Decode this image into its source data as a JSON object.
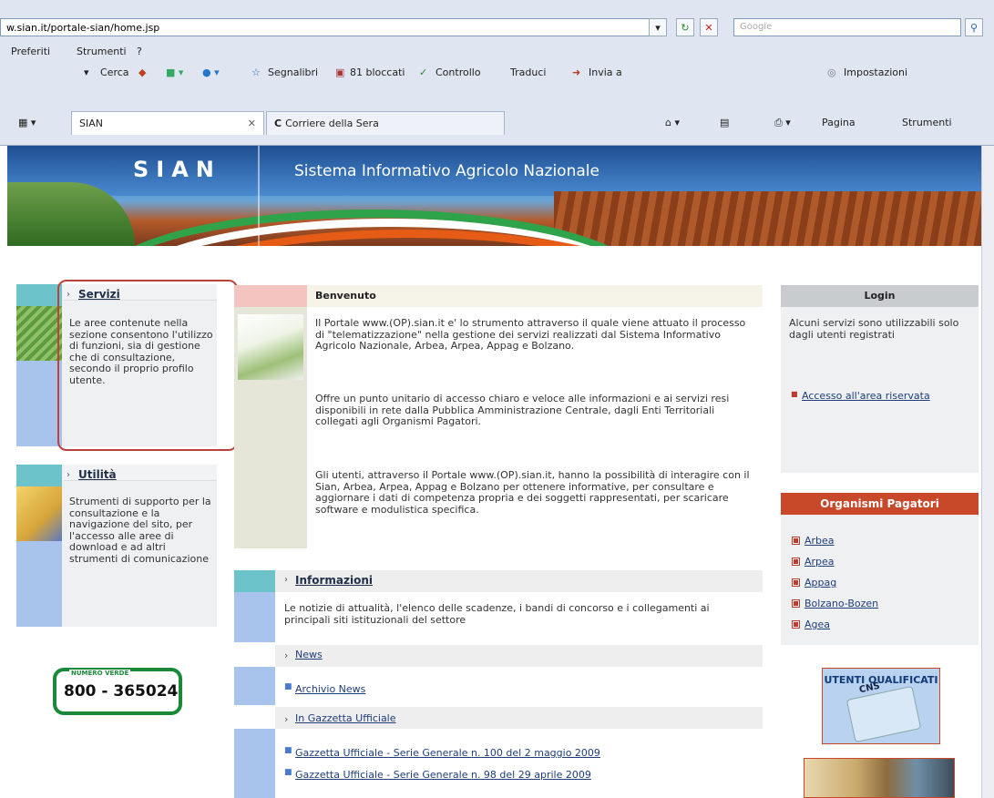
{
  "browser": {
    "url": "w.sian.it/portale-sian/home.jsp",
    "search_placeholder": "Google",
    "menu": [
      "Preferiti",
      "Strumenti",
      "?"
    ],
    "toolbar": {
      "cerca": "Cerca",
      "segnalibri": "Segnalibri",
      "bloccati": "81 bloccati",
      "controllo": "Controllo",
      "traduci": "Traduci",
      "invia": "Invia a",
      "impostazioni": "Impostazioni"
    },
    "tabs": [
      {
        "label": "SIAN",
        "active": true
      },
      {
        "label": "Corriere della Sera",
        "active": false
      }
    ],
    "tab_tools": {
      "pagina": "Pagina",
      "strumenti": "Strumenti"
    }
  },
  "banner": {
    "logo": "SIAN",
    "title": "Sistema Informativo Agricolo Nazionale"
  },
  "left": {
    "servizi": {
      "title": "Servizi",
      "text": "Le aree contenute nella sezione consentono l'utilizzo di funzioni, sia di gestione che di consultazione, secondo il proprio profilo utente."
    },
    "utilita": {
      "title": "Utilità",
      "text": "Strumenti di supporto per la consultazione e la navigazione del sito, per l'accesso alle aree di download e ad altri strumenti di comunicazione"
    },
    "numero_verde": {
      "label": "NUMERO VERDE",
      "number": "800 - 365024"
    }
  },
  "center": {
    "benvenuto": {
      "title": "Benvenuto",
      "p1": "Il Portale www.(OP).sian.it e' lo strumento attraverso il quale viene attuato il processo di \"telematizzazione\" nella gestione dei servizi realizzati dal Sistema Informativo Agricolo Nazionale, Arbea, Arpea, Appag e Bolzano.",
      "p2": "Offre un punto unitario di accesso chiaro e veloce alle informazioni e ai servizi resi disponibili in rete dalla Pubblica Amministrazione Centrale, dagli Enti Territoriali collegati agli Organismi Pagatori.",
      "p3": "Gli utenti, attraverso il Portale www.(OP).sian.it, hanno la possibilità di interagire con il Sian, Arbea, Arpea, Appag e Bolzano per ottenere informative, per consultare e aggiornare i dati di competenza propria e dei soggetti rappresentati, per scaricare software e modulistica specifica."
    },
    "informazioni": {
      "title": "Informazioni",
      "text": "Le notizie di attualità, l'elenco delle scadenze, i bandi di concorso e i collegamenti ai principali siti istituzionali del settore"
    },
    "news": {
      "news_label": "News",
      "archivio": "Archivio News",
      "gazzetta_label": "In Gazzetta Ufficiale",
      "gazzetta_items": [
        "Gazzetta Ufficiale - Serie Generale n. 100 del 2 maggio 2009",
        "Gazzetta Ufficiale - Serie Generale n. 98 del 29 aprile 2009"
      ]
    }
  },
  "right": {
    "login": {
      "title": "Login",
      "text": "Alcuni servizi sono utilizzabili solo dagli utenti registrati",
      "link": "Accesso all'area riservata"
    },
    "organismi": {
      "title": "Organismi Pagatori",
      "items": [
        "Arbea",
        "Arpea",
        "Appag",
        "Bolzano-Bozen",
        "Agea"
      ]
    },
    "utenti_qualificati": {
      "title": "UTENTI QUALIFICATI",
      "card": "CNS"
    }
  },
  "colors": {
    "teal": "#6cc3c9",
    "light_blue": "#a9c4ec",
    "highlight_red": "#c0413a",
    "organismi_red": "#c8482a",
    "numero_verde_green": "#1a8a3a"
  }
}
